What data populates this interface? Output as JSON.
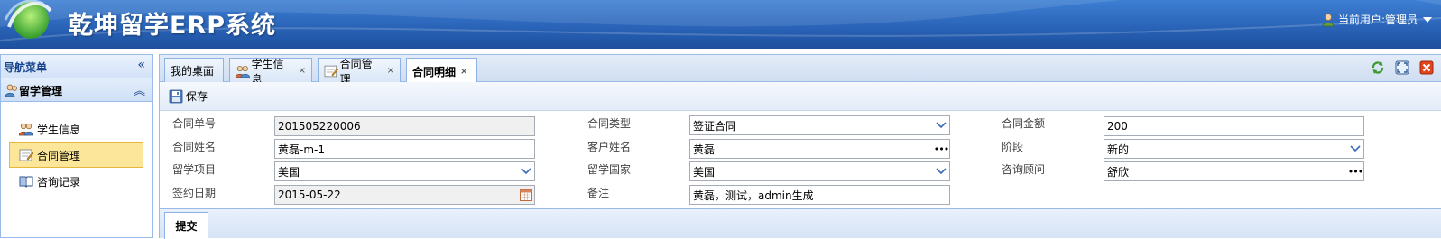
{
  "header": {
    "app_title": "乾坤留学ERP系统",
    "current_user_label": "当前用户:管理员"
  },
  "sidebar": {
    "title": "导航菜单",
    "collapse_glyph": "«",
    "group": {
      "title": "留学管理",
      "toggle_glyph": "︽"
    },
    "items": [
      {
        "label": "学生信息",
        "icon": "students-icon"
      },
      {
        "label": "合同管理",
        "icon": "contract-icon",
        "active": true
      },
      {
        "label": "咨询记录",
        "icon": "book-icon"
      }
    ]
  },
  "tabs": [
    {
      "label": "我的桌面"
    },
    {
      "label": "学生信息",
      "closable": "×"
    },
    {
      "label": "合同管理",
      "closable": "×"
    },
    {
      "label": "合同明细",
      "closable": "×",
      "active": true
    }
  ],
  "toolbar": {
    "save_label": "保存"
  },
  "form": {
    "contract_no_label": "合同单号",
    "contract_no": "201505220006",
    "contract_type_label": "合同类型",
    "contract_type": "签证合同",
    "contract_amount_label": "合同金额",
    "contract_amount": "200",
    "contract_name_label": "合同姓名",
    "contract_name": "黄磊-m-1",
    "customer_name_label": "客户姓名",
    "customer_name": "黄磊",
    "stage_label": "阶段",
    "stage": "新的",
    "study_program_label": "留学项目",
    "study_program": "美国",
    "study_country_label": "留学国家",
    "study_country": "美国",
    "consultant_label": "咨询顾问",
    "consultant": "舒欣",
    "sign_date_label": "签约日期",
    "sign_date": "2015-05-22",
    "remark_label": "备注",
    "remark": "黄磊，测试，admin生成"
  },
  "bottom": {
    "submit_label": "提交"
  },
  "colors": {
    "header_blue": "#2a64b8",
    "active_item": "#fbe69a",
    "panel_border": "#99bbe8"
  }
}
